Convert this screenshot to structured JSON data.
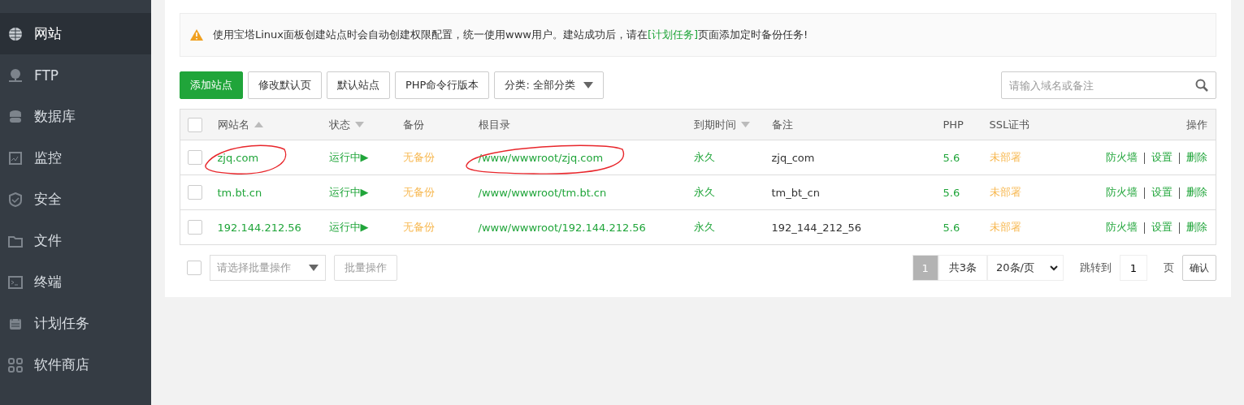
{
  "sidebar": {
    "items": [
      {
        "label": "网站",
        "selected": true
      },
      {
        "label": "FTP",
        "selected": false
      },
      {
        "label": "数据库",
        "selected": false
      },
      {
        "label": "监控",
        "selected": false
      },
      {
        "label": "安全",
        "selected": false
      },
      {
        "label": "文件",
        "selected": false
      },
      {
        "label": "终端",
        "selected": false
      },
      {
        "label": "计划任务",
        "selected": false
      },
      {
        "label": "软件商店",
        "selected": false
      }
    ]
  },
  "notice": {
    "before": "使用宝塔Linux面板创建站点时会自动创建权限配置，统一使用www用户。建站成功后，请在",
    "link": "[计划任务]",
    "after": "页面添加定时备份任务!"
  },
  "toolbar": {
    "primary": "添加站点",
    "buttons": [
      "修改默认页",
      "默认站点",
      "PHP命令行版本"
    ],
    "category": "分类: 全部分类",
    "search": {
      "placeholder": "请输入域名或备注"
    }
  },
  "table": {
    "header_checked": false,
    "columns": [
      {
        "label": "网站名",
        "sortable": true
      },
      {
        "label": "状态",
        "sortable": true
      },
      {
        "label": "备份",
        "sortable": false
      },
      {
        "label": "根目录",
        "sortable": false
      },
      {
        "label": "到期时间",
        "sortable": true
      },
      {
        "label": "备注",
        "sortable": false
      },
      {
        "label": "PHP",
        "sortable": false
      },
      {
        "label": "SSL证书",
        "sortable": false
      },
      {
        "label": "操作",
        "sortable": false
      }
    ],
    "rows": [
      {
        "checked": false,
        "name": "zjq.com",
        "name_circled": true,
        "status": "运行中▶",
        "backup": "无备份",
        "root": "/www/wwwroot/zjq.com",
        "root_circled": true,
        "expiry": "永久",
        "remark": "zjq_com",
        "php": "5.6",
        "ssl": "未部署",
        "actions": [
          "防火墙",
          "设置",
          "删除"
        ]
      },
      {
        "checked": false,
        "name": "tm.bt.cn",
        "name_circled": false,
        "status": "运行中▶",
        "backup": "无备份",
        "root": "/www/wwwroot/tm.bt.cn",
        "root_circled": false,
        "expiry": "永久",
        "remark": "tm_bt_cn",
        "php": "5.6",
        "ssl": "未部署",
        "actions": [
          "防火墙",
          "设置",
          "删除"
        ]
      },
      {
        "checked": false,
        "name": "192.144.212.56",
        "name_circled": false,
        "status": "运行中▶",
        "backup": "无备份",
        "root": "/www/wwwroot/192.144.212.56",
        "root_circled": false,
        "expiry": "永久",
        "remark": "192_144_212_56",
        "php": "5.6",
        "ssl": "未部署",
        "actions": [
          "防火墙",
          "设置",
          "删除"
        ]
      }
    ]
  },
  "footer": {
    "checked": false,
    "batch_placeholder": "请选择批量操作",
    "batch_button": "批量操作",
    "pagination": {
      "pages": [
        {
          "label": "1",
          "selected": true
        }
      ],
      "total": "共3条",
      "page_size": "20条/页",
      "jump_label": "跳转到",
      "jump_value": "1",
      "page_unit": "页",
      "confirm": "确认"
    }
  }
}
